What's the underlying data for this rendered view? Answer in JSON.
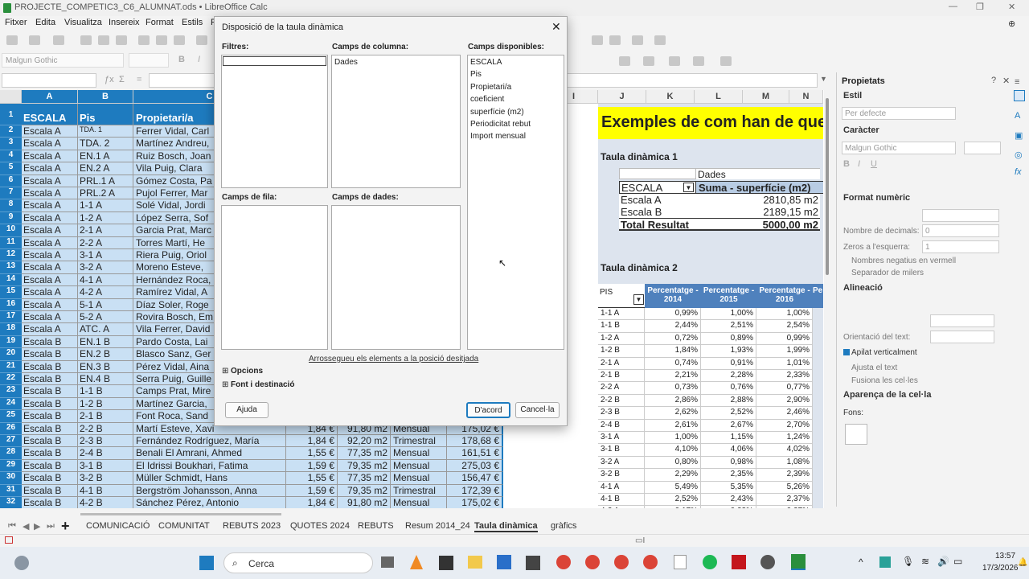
{
  "window": {
    "title": "PROJECTE_COMPETIC3_C6_ALUMNAT.ods • LibreOffice Calc"
  },
  "menu": [
    "Fitxer",
    "Edita",
    "Visualitza",
    "Insereix",
    "Format",
    "Estils",
    "Fu"
  ],
  "toolbar": {
    "font_name": "Malgun Gothic"
  },
  "columns": [
    "A",
    "B",
    "C",
    "I",
    "J",
    "K",
    "L",
    "M",
    "N"
  ],
  "col_headers": {
    "a": "ESCALA",
    "b": "Pis",
    "c": "Propietari/a"
  },
  "rows": [
    [
      "Escala A",
      "TDA. 1",
      "Ferrer Vidal, Carl",
      "",
      "",
      "",
      ""
    ],
    [
      "Escala A",
      "TDA. 2",
      "Martínez Andreu,",
      "",
      "",
      "",
      ""
    ],
    [
      "Escala A",
      "EN.1 A",
      "Ruiz Bosch, Joan",
      "",
      "",
      "",
      ""
    ],
    [
      "Escala A",
      "EN.2 A",
      "Vila Puig, Clara",
      "",
      "",
      "",
      ""
    ],
    [
      "Escala A",
      "PRL.1 A",
      "Gómez Costa, Pa",
      "",
      "",
      "",
      ""
    ],
    [
      "Escala A",
      "PRL.2 A",
      "Pujol Ferrer, Mar",
      "",
      "",
      "",
      ""
    ],
    [
      "Escala A",
      "1-1 A",
      "Solé Vidal, Jordi",
      "",
      "",
      "",
      ""
    ],
    [
      "Escala A",
      "1-2 A",
      "López Serra, Sof",
      "",
      "",
      "",
      ""
    ],
    [
      "Escala A",
      "2-1 A",
      "Garcia Prat, Marc",
      "",
      "",
      "",
      ""
    ],
    [
      "Escala A",
      "2-2 A",
      "Torres Martí, He",
      "",
      "",
      "",
      ""
    ],
    [
      "Escala A",
      "3-1 A",
      "Riera Puig, Oriol",
      "",
      "",
      "",
      ""
    ],
    [
      "Escala A",
      "3-2 A",
      "Moreno Esteve, ",
      "",
      "",
      "",
      ""
    ],
    [
      "Escala A",
      "4-1 A",
      "Hernández Roca,",
      "",
      "",
      "",
      ""
    ],
    [
      "Escala A",
      "4-2 A",
      "Ramírez Vidal, A",
      "",
      "",
      "",
      ""
    ],
    [
      "Escala A",
      "5-1 A",
      "Díaz Soler, Roge",
      "",
      "",
      "",
      ""
    ],
    [
      "Escala A",
      "5-2 A",
      "Rovira Bosch, Em",
      "",
      "",
      "",
      ""
    ],
    [
      "Escala A",
      "ATC. A",
      "Vila Ferrer, David",
      "",
      "",
      "",
      ""
    ],
    [
      "Escala B",
      "EN.1 B",
      "Pardo Costa, Lai",
      "",
      "",
      "",
      ""
    ],
    [
      "Escala B",
      "EN.2 B",
      "Blasco Sanz, Ger",
      "",
      "",
      "",
      ""
    ],
    [
      "Escala B",
      "EN.3 B",
      "Pérez Vidal, Aina",
      "",
      "",
      "",
      ""
    ],
    [
      "Escala B",
      "EN.4 B",
      "Serra Puig, Guille",
      "",
      "",
      "",
      ""
    ],
    [
      "Escala B",
      "1-1 B",
      "Camps Prat, Mire",
      "",
      "",
      "",
      ""
    ],
    [
      "Escala B",
      "1-2 B",
      "Martínez Garcia,",
      "",
      "",
      "",
      ""
    ],
    [
      "Escala B",
      "2-1 B",
      "Font Roca, Sand",
      "",
      "",
      "",
      ""
    ],
    [
      "Escala B",
      "2-2 B",
      "Martí Esteve, Xavi",
      "1,84 €",
      "91,80 m2",
      "Mensual",
      "175,02 €"
    ],
    [
      "Escala B",
      "2-3 B",
      "Fernández Rodríguez, María",
      "1,84 €",
      "92,20 m2",
      "Trimestral",
      "178,68 €"
    ],
    [
      "Escala B",
      "2-4 B",
      "Benali El Amrani, Ahmed",
      "1,55 €",
      "77,35 m2",
      "Mensual",
      "161,51 €"
    ],
    [
      "Escala B",
      "3-1 B",
      "El Idrissi Boukhari, Fatima",
      "1,59 €",
      "79,35 m2",
      "Mensual",
      "275,03 €"
    ],
    [
      "Escala B",
      "3-2 B",
      "Müller Schmidt, Hans",
      "1,55 €",
      "77,35 m2",
      "Mensual",
      "156,47 €"
    ],
    [
      "Escala B",
      "4-1 B",
      "Bergström Johansson, Anna",
      "1,59 €",
      "79,35 m2",
      "Trimestral",
      "172,39 €"
    ],
    [
      "Escala B",
      "4-2 B",
      "Sánchez Pérez, Antonio",
      "1,84 €",
      "91,80 m2",
      "Mensual",
      "175,02 €"
    ]
  ],
  "right": {
    "heading": "Exemples de com han de que",
    "pivot1_title": "Taula dinàmica 1",
    "pivot1": {
      "dades": "Dades",
      "field": "ESCALA",
      "sum_label": "Suma - superfície (m2)",
      "rows": [
        [
          "Escala A",
          "2810,85 m2"
        ],
        [
          "Escala B",
          "2189,15 m2"
        ]
      ],
      "total_label": "Total Resultat",
      "total_value": "5000,00 m2"
    },
    "pivot2_title": "Taula dinàmica 2",
    "pivot2_headers": [
      "PIS",
      "Percentatge - 2014",
      "Percentatge - 2015",
      "Percentatge - 2016",
      "Pe"
    ],
    "pivot2_rows": [
      [
        "1-1 A",
        "0,99%",
        "1,00%",
        "1,00%"
      ],
      [
        "1-1 B",
        "2,44%",
        "2,51%",
        "2,54%"
      ],
      [
        "1-2 A",
        "0,72%",
        "0,89%",
        "0,99%"
      ],
      [
        "1-2 B",
        "1,84%",
        "1,93%",
        "1,99%"
      ],
      [
        "2-1 A",
        "0,74%",
        "0,91%",
        "1,01%"
      ],
      [
        "2-1 B",
        "2,21%",
        "2,28%",
        "2,33%"
      ],
      [
        "2-2 A",
        "0,73%",
        "0,76%",
        "0,77%"
      ],
      [
        "2-2 B",
        "2,86%",
        "2,88%",
        "2,90%"
      ],
      [
        "2-3 B",
        "2,62%",
        "2,52%",
        "2,46%"
      ],
      [
        "2-4 B",
        "2,61%",
        "2,67%",
        "2,70%"
      ],
      [
        "3-1 A",
        "1,00%",
        "1,15%",
        "1,24%"
      ],
      [
        "3-1 B",
        "4,10%",
        "4,06%",
        "4,02%"
      ],
      [
        "3-2 A",
        "0,80%",
        "0,98%",
        "1,08%"
      ],
      [
        "3-2 B",
        "2,29%",
        "2,35%",
        "2,39%"
      ],
      [
        "4-1 A",
        "5,49%",
        "5,35%",
        "5,26%"
      ],
      [
        "4-1 B",
        "2,52%",
        "2,43%",
        "2,37%"
      ],
      [
        "4-2 A",
        "0,17%",
        "0,23%",
        "0,27%"
      ],
      [
        "4-2 B",
        "2,57%",
        "2,63%",
        "2,66%"
      ]
    ]
  },
  "sheets": [
    "COMUNICACIÓ",
    "COMUNITAT",
    "REBUTS 2023",
    "QUOTES 2024",
    "REBUTS",
    "Resum 2014_24",
    "Taula dinàmica",
    "gràfics"
  ],
  "active_sheet": "Taula dinàmica",
  "sidebar": {
    "title": "Propietats",
    "estil": "Estil",
    "estil_value": "Per defecte",
    "caracter": "Caràcter",
    "font": "Malgun Gothic",
    "format_numeric": "Format numèric",
    "decimals_label": "Nombre de decimals:",
    "decimals_value": "0",
    "zeros_label": "Zeros a l'esquerra:",
    "zeros_value": "1",
    "negatius": "Nombres negatius en vermell",
    "separador": "Separador de milers",
    "alineacio": "Alineació",
    "orientacio": "Orientació del text:",
    "apilat": "Apilat verticalment",
    "ajusta": "Ajusta el text",
    "fusiona": "Fusiona les cel·les",
    "aparenca": "Aparença de la cel·la",
    "fons": "Fons:"
  },
  "dialog": {
    "title": "Disposició de la taula dinàmica",
    "filtres": "Filtres:",
    "camps_columna": "Camps de columna:",
    "camps_fila": "Camps de fila:",
    "camps_dades": "Camps de dades:",
    "camps_disponibles": "Camps disponibles:",
    "columna_items": [
      "Dades"
    ],
    "disponibles_items": [
      "ESCALA",
      "Pis",
      "Propietari/a",
      "coeficient",
      "superfície (m2)",
      "Periodicitat rebut",
      "Import mensual"
    ],
    "hint": "Arrossegueu els elements a la posició desitjada",
    "opcions": "Opcions",
    "font_desti": "Font i destinació",
    "ajuda": "Ajuda",
    "dacord": "D'acord",
    "cancel": "Cancel·la"
  },
  "taskbar": {
    "search": "Cerca",
    "time": "13:57",
    "date": "17/3/2026"
  },
  "colors": {
    "accent": "#1e7bbf",
    "heading_bg": "#ffff00",
    "cell_bg": "#c9e0f4"
  }
}
